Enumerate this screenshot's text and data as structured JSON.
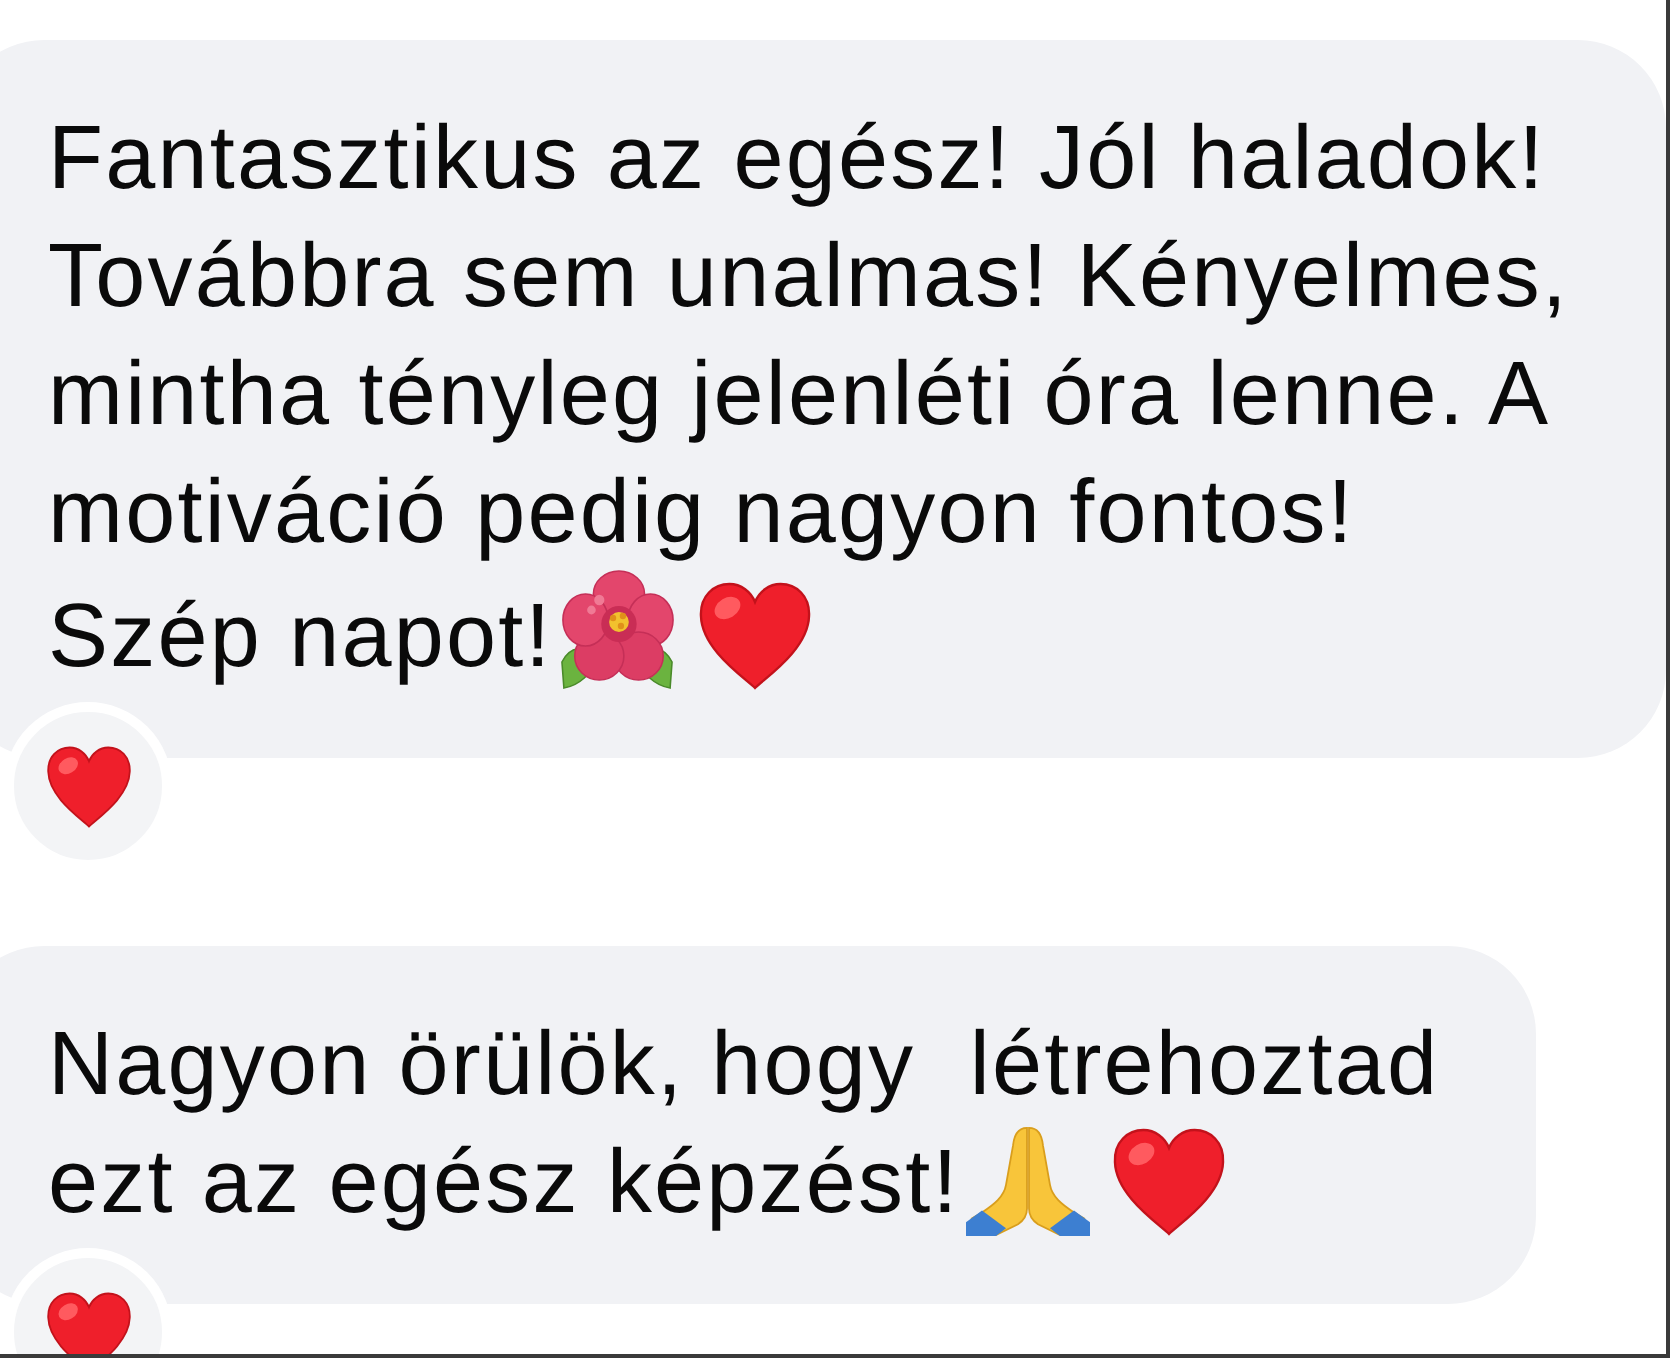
{
  "messages": [
    {
      "lines": [
        "Fantasztikus az egész! Jól haladok!",
        "Továbbra sem unalmas! Kényelmes,",
        "mintha tényleg jelenléti óra lenne. A",
        "motiváció pedig nagyon fontos!",
        "Szép napot!"
      ],
      "emoji": [
        {
          "kind": "hibiscus"
        },
        {
          "kind": "heart"
        }
      ],
      "reactions": [
        {
          "kind": "heart"
        }
      ]
    },
    {
      "lines": [
        "Nagyon örülök, hogy  létrehoztad",
        "ezt az egész képzést!"
      ],
      "emoji": [
        {
          "kind": "folded_hands"
        },
        {
          "kind": "heart"
        }
      ],
      "reactions": [
        {
          "kind": "heart"
        }
      ]
    }
  ]
}
